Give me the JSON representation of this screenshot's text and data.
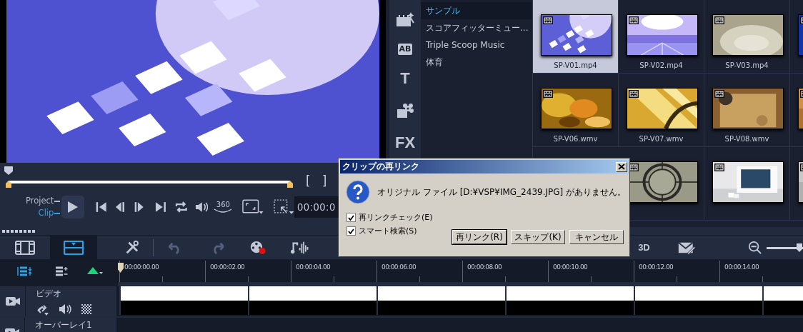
{
  "scrubber": {
    "level": 0
  },
  "playback": {
    "modes": [
      {
        "label": "Project",
        "selected": false
      },
      {
        "label": "Clip",
        "selected": true
      }
    ],
    "brackets": [
      "[",
      "]"
    ],
    "vr_label": "360",
    "timecode": "00:00:0"
  },
  "library": {
    "side_tabs": [
      {
        "kind": "media"
      },
      {
        "kind": "boxed",
        "glyph": "AB"
      },
      {
        "kind": "text",
        "glyph": "T"
      },
      {
        "kind": "filter"
      },
      {
        "kind": "text",
        "glyph": "FX"
      }
    ],
    "folders": [
      {
        "label": "サンプル",
        "selected": true
      },
      {
        "label": "スコアフィッターミュー...",
        "selected": false
      },
      {
        "label": "Triple Scoop Music",
        "selected": false
      },
      {
        "label": "体育",
        "selected": false
      }
    ],
    "clip_rows": [
      [
        {
          "name": "SP-V01.mp4",
          "selected": true
        },
        {
          "name": "SP-V02.mp4",
          "selected": false
        },
        {
          "name": "SP-V03.mp4",
          "selected": false
        },
        {
          "selected": false
        }
      ],
      [
        {
          "name": "SP-V06.wmv",
          "selected": false
        },
        {
          "name": "SP-V07.wmv",
          "selected": false
        },
        {
          "name": "SP-V08.wmv",
          "selected": false
        },
        {
          "selected": false
        }
      ],
      [
        {
          "selected": false
        },
        {
          "selected": false
        },
        {
          "selected": false
        }
      ]
    ]
  },
  "toolbar": {
    "views": [
      {
        "selected": false
      },
      {
        "selected": true
      }
    ],
    "label_3d": "3D",
    "zoom": {
      "level": 0.9
    }
  },
  "timeline": {
    "ruler": [
      "00:00:00.00",
      "00:00:02.00",
      "00:00:04.00",
      "00:00:06.00",
      "00:00:08.00",
      "00:00:10.00",
      "00:00:12.00",
      "00:00:14.00"
    ],
    "tracks": [
      {
        "kind": "video",
        "name": "ビデオ"
      },
      {
        "kind": "overlay",
        "name": "オーバーレイ1"
      }
    ]
  },
  "dialog": {
    "title": "クリップの再リンク",
    "message": "オリジナル ファイル [D:¥VSP¥IMG_2439.JPG] がありません。",
    "options": [
      {
        "label": "再リンクチェック(E)",
        "checked": true
      },
      {
        "label": "スマート検索(S)",
        "checked": true
      }
    ],
    "buttons": [
      {
        "label": "再リンク(R)",
        "default": true
      },
      {
        "label": "スキップ(K)",
        "default": false
      },
      {
        "label": "キャンセル",
        "default": false
      }
    ]
  }
}
